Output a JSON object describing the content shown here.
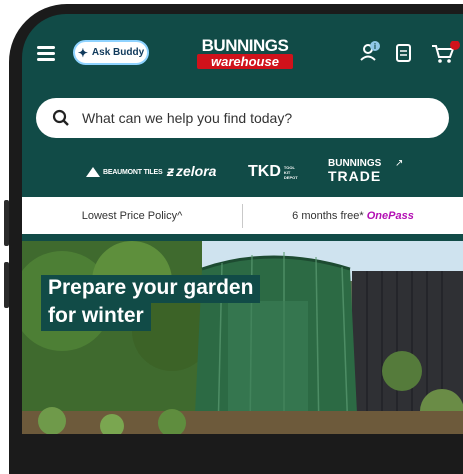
{
  "header": {
    "ask_buddy_label": "Ask Buddy",
    "logo_top": "BUNNINGS",
    "logo_bottom": "warehouse",
    "icons": [
      "menu-icon",
      "account-icon",
      "list-icon",
      "cart-icon"
    ]
  },
  "search": {
    "placeholder": "What can we help you find today?"
  },
  "partners": {
    "beaumont": "BEAUMONT TILES",
    "zelora": "zelora",
    "tkd": "TKD",
    "tkd_sub": "TOOL KIT DEPOT",
    "trade_top": "BUNNINGS",
    "trade_bottom": "TRADE"
  },
  "promo": {
    "left": "Lowest Price Policy^",
    "right_text": "6 months free* ",
    "right_brand": "OnePass"
  },
  "hero": {
    "title_line1": "Prepare your garden",
    "title_line2": "for winter"
  },
  "colors": {
    "brand_teal": "#114b47",
    "bunnings_red": "#d0121b",
    "onepass": "#b30fb3"
  }
}
